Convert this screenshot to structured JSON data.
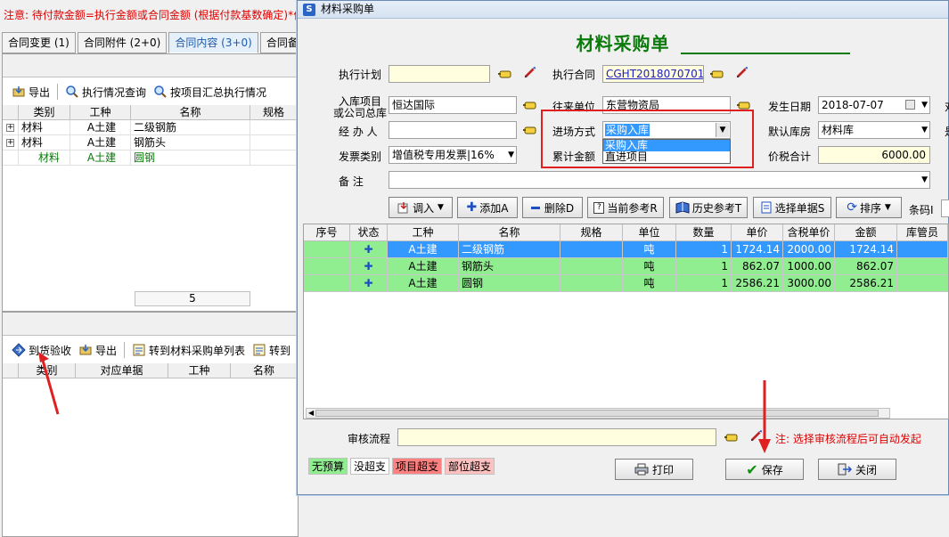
{
  "left": {
    "note": "注意: 待付款金额=执行金额或合同金额 (根据付款基数确定)*付",
    "tabs": [
      {
        "label": "合同变更 (1)"
      },
      {
        "label": "合同附件 (2+0)"
      },
      {
        "label": "合同内容 (3+0)"
      },
      {
        "label": "合同备"
      }
    ],
    "toolbar1": {
      "export": "导出",
      "exec_query": "执行情况查询",
      "by_project": "按项目汇总执行情况"
    },
    "grid1": {
      "headers": [
        "类别",
        "工种",
        "名称",
        "规格"
      ],
      "rows": [
        {
          "cat": "材料",
          "trade": "A土建",
          "name": "二级钢筋"
        },
        {
          "cat": "材料",
          "trade": "A土建",
          "name": "钢筋头"
        },
        {
          "cat": "材料",
          "trade": "A土建",
          "name": "圆钢"
        }
      ],
      "footer_count": "5"
    },
    "toolbar2": {
      "arrival": "到货验收",
      "export": "导出",
      "to_list": "转到材料采购单列表",
      "to_more": "转到"
    },
    "grid2": {
      "headers": [
        "类别",
        "对应单据",
        "工种",
        "名称"
      ]
    }
  },
  "dialog": {
    "window_title": "材料采购单",
    "heading": "材料采购单",
    "form": {
      "exec_plan_label": "执行计划",
      "exec_plan_value": "",
      "exec_contract_label": "执行合同",
      "exec_contract_value": "CGHT2018070701",
      "project_label_1": "入库项目",
      "project_label_2": "或公司总库",
      "project_value": "恒达国际",
      "counterpart_label": "往来单位",
      "counterpart_value": "东营物资局",
      "date_label": "发生日期",
      "date_value": "2018-07-07",
      "handler_label": "经 办 人",
      "handler_value": "",
      "entry_mode_label": "进场方式",
      "entry_mode_value": "采购入库",
      "entry_mode_options": [
        "采购入库",
        "直进项目"
      ],
      "default_wh_label": "默认库房",
      "default_wh_value": "材料库",
      "invoice_label": "发票类别",
      "invoice_value": "增值税专用发票|16%",
      "accum_label": "累计金额",
      "total_label": "价税合计",
      "total_value": "6000.00",
      "remark_label": "备  注",
      "remark_value": "",
      "right_cut_1": "对",
      "right_cut_2": "是"
    },
    "buttons": {
      "import": "调入",
      "add": "添加A",
      "delete": "删除D",
      "cur_ref": "当前参考R",
      "hist_ref": "历史参考T",
      "select_doc": "选择单据S",
      "sort": "排序",
      "barcode": "条码I"
    },
    "grid": {
      "headers": [
        "序号",
        "状态",
        "工种",
        "名称",
        "规格",
        "单位",
        "数量",
        "单价",
        "含税单价",
        "金额",
        "库管员"
      ],
      "rows": [
        {
          "trade": "A土建",
          "name": "二级钢筋",
          "unit": "吨",
          "qty": "1",
          "price": "1724.14",
          "tax_price": "2000.00",
          "amount": "1724.14"
        },
        {
          "trade": "A土建",
          "name": "钢筋头",
          "unit": "吨",
          "qty": "1",
          "price": "862.07",
          "tax_price": "1000.00",
          "amount": "862.07"
        },
        {
          "trade": "A土建",
          "name": "圆钢",
          "unit": "吨",
          "qty": "1",
          "price": "2586.21",
          "tax_price": "3000.00",
          "amount": "2586.21"
        }
      ]
    },
    "audit": {
      "label": "审核流程",
      "value": "",
      "note": "注: 选择审核流程后可自动发起"
    },
    "legend": [
      "无预算",
      "没超支",
      "项目超支",
      "部位超支"
    ],
    "footer": {
      "print": "打印",
      "save": "保存",
      "close": "关闭"
    }
  },
  "colors": {
    "selected_row": "#3399ff",
    "green_row": "#90ee90",
    "heading": "#0a7a0a",
    "annotation": "#e02020"
  }
}
